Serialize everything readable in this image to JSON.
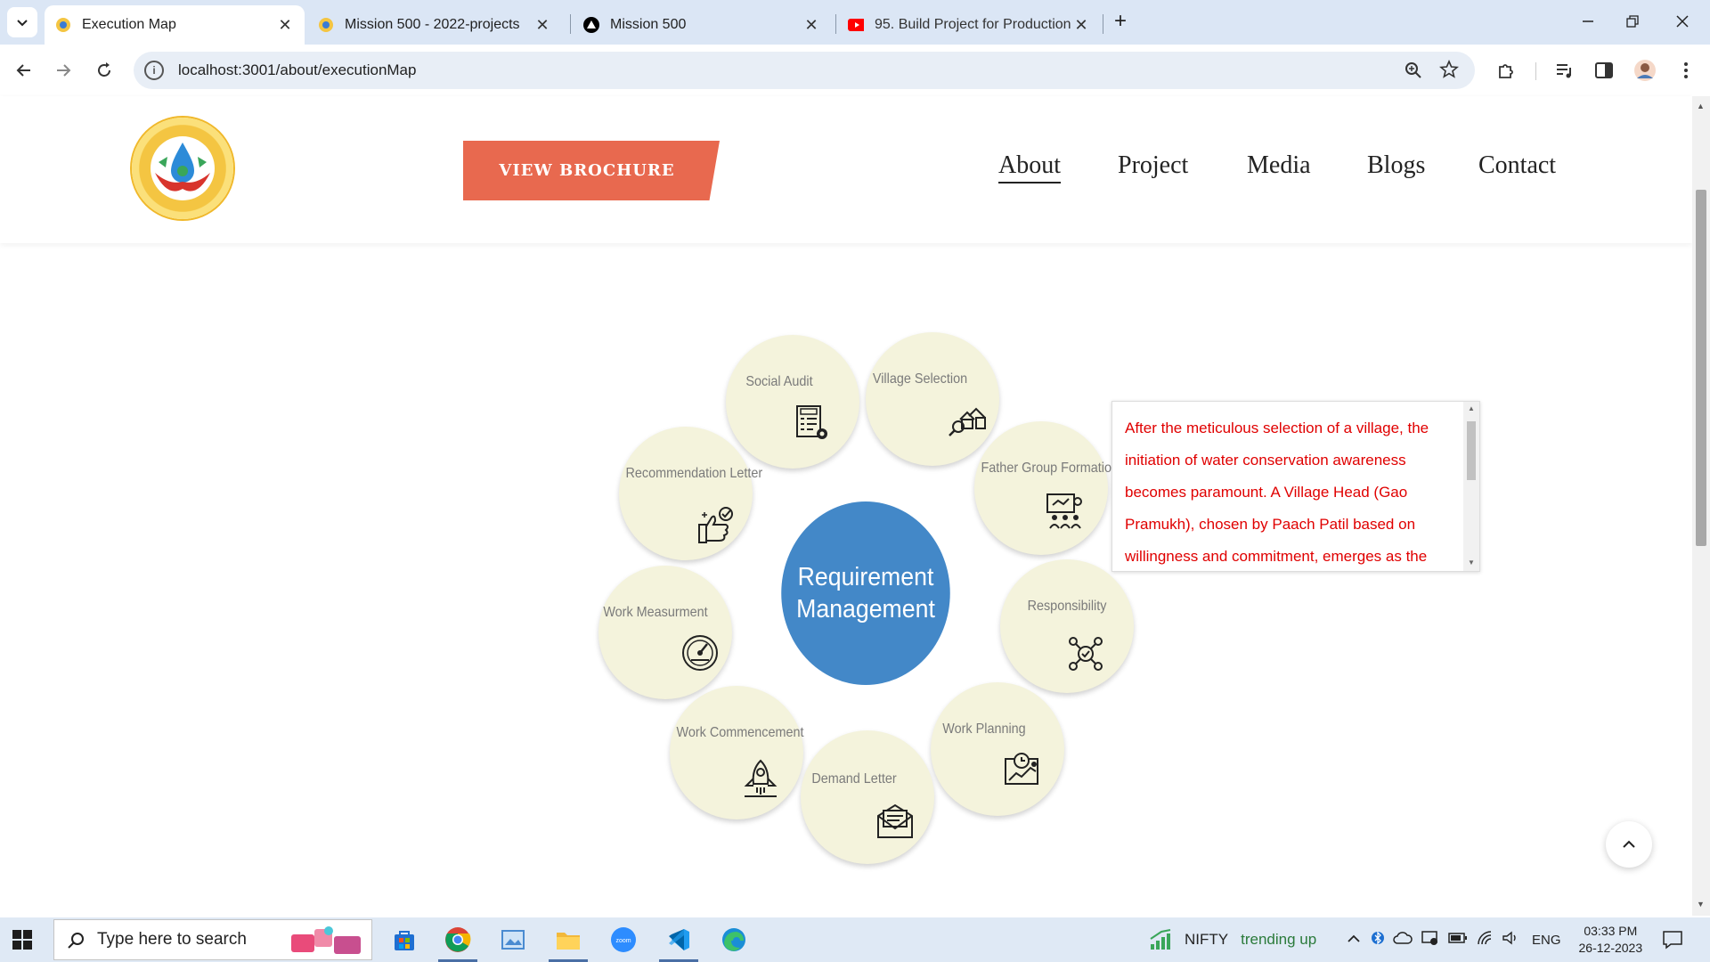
{
  "browser": {
    "tabs": [
      {
        "title": "Execution Map",
        "active": true
      },
      {
        "title": "Mission 500 - 2022-projects",
        "active": false
      },
      {
        "title": "Mission 500",
        "active": false
      },
      {
        "title": "95. Build Project for Production",
        "active": false
      }
    ],
    "new_tab": "+",
    "url": "localhost:3001/about/executionMap"
  },
  "header": {
    "brochure_label": "VIEW BROCHURE",
    "nav": [
      "About",
      "Project",
      "Media",
      "Blogs",
      "Contact"
    ],
    "active_nav": "About"
  },
  "map": {
    "center_line1": "Requirement",
    "center_line2": "Management",
    "steps": [
      {
        "label": "Social Audit",
        "icon": "audit-icon"
      },
      {
        "label": "Village Selection",
        "icon": "village-search-icon"
      },
      {
        "label": "Father Group Formation",
        "icon": "group-presentation-icon"
      },
      {
        "label": "Responsibility",
        "icon": "team-network-icon"
      },
      {
        "label": "Work Planning",
        "icon": "planning-board-icon"
      },
      {
        "label": "Demand Letter",
        "icon": "envelope-letter-icon"
      },
      {
        "label": "Work Commencement",
        "icon": "rocket-launch-icon"
      },
      {
        "label": "Work Measurment",
        "icon": "gauge-icon"
      },
      {
        "label": "Recommendation Letter",
        "icon": "thumbs-up-check-icon"
      }
    ],
    "description": "After the meticulous selection of a village, the initiation of water conservation awareness becomes paramount. A Village Head (Gao Pramukh), chosen by Paach Patil based on willingness and commitment, emerges as the linchpin between the Paach Patil team and the villagers."
  },
  "taskbar": {
    "search_placeholder": "Type here to search",
    "widget_name": "NIFTY",
    "widget_status": "trending up",
    "language": "ENG",
    "time": "03:33 PM",
    "date": "26-12-2023"
  },
  "colors": {
    "brochure": "#e8694f",
    "center": "#4388c8",
    "step_bg": "#f4f3dc",
    "description_text": "#e00000"
  }
}
